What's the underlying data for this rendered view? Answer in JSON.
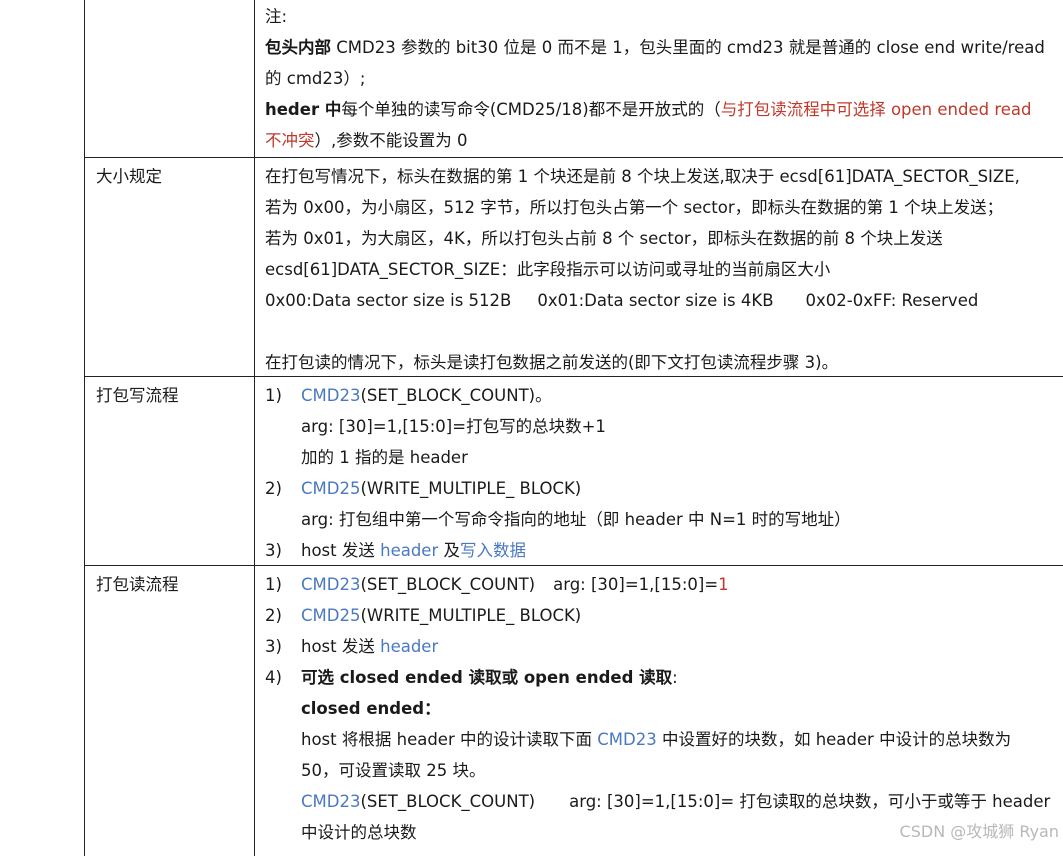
{
  "rows": [
    {
      "label": "",
      "lines": {
        "l1": "注:",
        "l2_bold": "包头内部",
        "l2_rest": " CMD23 参数的 bit30 位是 0 而不是 1，包头里面的 cmd23 就是普通的 close end write/read",
        "l3": "的 cmd23）;",
        "l4_bold": "heder 中",
        "l4_rest": "每个单独的读写命令(CMD25/18)都不是开放式的（",
        "l4_red": "与打包读流程中可选择 open ended read",
        "l5_red": "不冲突",
        "l5_rest": "）,参数不能设置为 0"
      }
    },
    {
      "label": "大小规定",
      "lines": {
        "l1": "在打包写情况下，标头在数据的第 1 个块还是前 8 个块上发送,取决于 ecsd[61]DATA_SECTOR_SIZE,",
        "l2": "若为 0x00，为小扇区，512 字节，所以打包头占第一个 sector，即标头在数据的第 1 个块上发送；",
        "l3": "若为 0x01，为大扇区，4K，所以打包头占前 8 个 sector，即标头在数据的前 8 个块上发送",
        "l4": "ecsd[61]DATA_SECTOR_SIZE：此字段指示可以访问或寻址的当前扇区大小",
        "l5a": "0x00:Data sector size is 512B",
        "l5b": "0x01:Data sector size is 4KB",
        "l5c": "0x02-0xFF: Reserved",
        "l7": "在打包读的情况下，标头是读打包数据之前发送的(即下文打包读流程步骤 3)。"
      }
    },
    {
      "label": "打包写流程",
      "steps": {
        "s1_num": "1)",
        "s1_cmd": "CMD23",
        "s1_rest": "(SET_BLOCK_COUNT)。",
        "s1_arg": "arg: [30]=1,[15:0]=打包写的总块数+1",
        "s1_note": "加的 1 指的是 header",
        "s2_num": "2)",
        "s2_cmd": "CMD25",
        "s2_rest": "(WRITE_MULTIPLE_ BLOCK)",
        "s2_arg": "arg: 打包组中第一个写命令指向的地址（即 header 中 N=1 时的写地址）",
        "s3_num": "3)",
        "s3_pre": "host 发送 ",
        "s3_blue1": "header",
        "s3_mid": " 及",
        "s3_blue2": "写入数据"
      }
    },
    {
      "label": "打包读流程",
      "steps": {
        "s1_num": "1)",
        "s1_cmd": "CMD23",
        "s1_rest": "(SET_BLOCK_COUNT)",
        "s1_arg": "arg: [30]=1,[15:0]=",
        "s1_red": "1",
        "s2_num": "2)",
        "s2_cmd": "CMD25",
        "s2_rest": "(WRITE_MULTIPLE_ BLOCK)",
        "s3_num": "3)",
        "s3_pre": "host 发送 ",
        "s3_blue": "header",
        "s4_num": "4)",
        "s4_bold": "可选 closed ended 读取或 open ended 读取",
        "s4_colon": ":",
        "closed_label": "closed ended：",
        "c1_pre": "host 将根据 header 中的设计读取下面 ",
        "c1_blue": "CMD23",
        "c1_rest": " 中设置好的块数，如 header 中设计的总块数为",
        "c2": "50，可设置读取 25 块。",
        "c3_blue": "CMD23",
        "c3_rest": "(SET_BLOCK_COUNT)",
        "c3_arg": "arg: [30]=1,[15:0]= 打包读取的总块数，可小于或等于 header",
        "c4": "中设计的总块数"
      }
    }
  ],
  "watermark": "CSDN @攻城狮 Ryan"
}
